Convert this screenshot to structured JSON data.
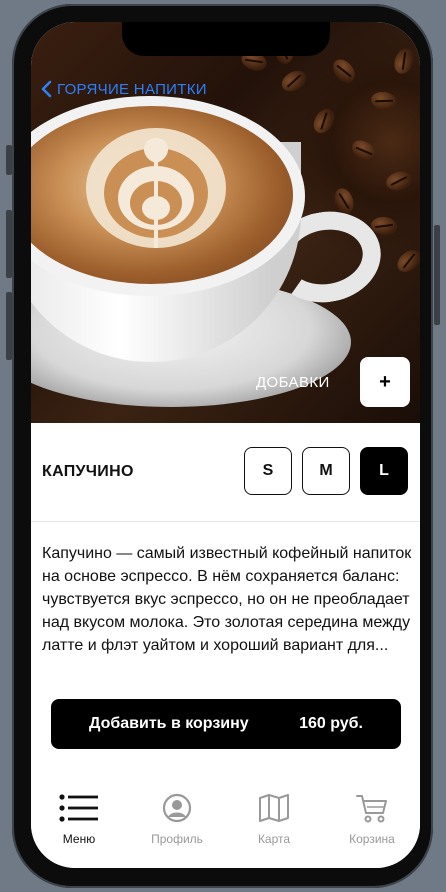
{
  "nav": {
    "back_label": "ГОРЯЧИЕ НАПИТКИ"
  },
  "hero": {
    "addons_label": "ДОБАВКИ",
    "add_symbol": "+"
  },
  "product": {
    "title": "КАПУЧИНО",
    "sizes": [
      "S",
      "M",
      "L"
    ],
    "selected_size": "L",
    "description": "Капучино — самый известный кофейный напиток на основе эспрессо. В нём сохраняется баланс: чувствуется вкус эспрессо, но он не преобладает над вкусом молока. Это золотая середина между латте и флэт уайтом и хороший вариант для..."
  },
  "cart_button": {
    "label": "Добавить в корзину",
    "price": "160 руб."
  },
  "tabbar": {
    "items": [
      {
        "label": "Меню",
        "icon": "menu-icon",
        "active": true
      },
      {
        "label": "Профиль",
        "icon": "profile-icon",
        "active": false
      },
      {
        "label": "Карта",
        "icon": "map-icon",
        "active": false
      },
      {
        "label": "Корзина",
        "icon": "cart-icon",
        "active": false
      }
    ]
  },
  "colors": {
    "accent": "#2d7ff9",
    "primary": "#000000",
    "inactive": "#999999"
  }
}
